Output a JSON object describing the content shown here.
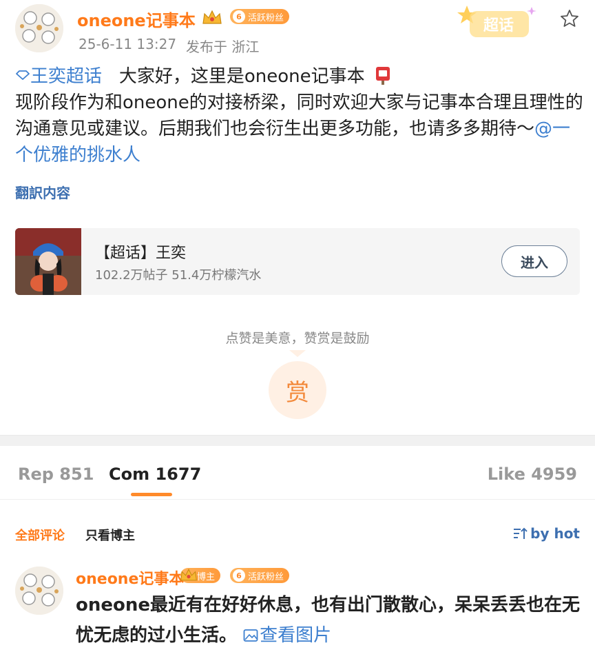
{
  "post": {
    "username": "oneone记事本",
    "fan_badge": {
      "level": "6",
      "label": "活跃粉丝"
    },
    "timestamp": "25-6-11 13:27",
    "location": "发布于 浙江",
    "supertopic_tag": "超话",
    "topic_link": "王奕超话",
    "line1_text": "大家好，这里是oneone记事本",
    "body_text": "现阶段作为和oneone的对接桥梁，同时欢迎大家与记事本合理且理性的沟通意见或建议。后期我们也会衍生出更多功能，也请多多期待～",
    "mention": "@一个优雅的挑水人",
    "translate_label": "翻訳内容"
  },
  "topic_card": {
    "title": "【超话】王奕",
    "stats": "102.2万帖子 51.4万柠檬汽水",
    "enter_label": "进入"
  },
  "reward": {
    "hint": "点赞是美意，赞赏是鼓励",
    "button_label": "赏"
  },
  "tabs": {
    "reposts": "Rep 851",
    "comments": "Com 1677",
    "likes": "Like 4959"
  },
  "filters": {
    "all": "全部评论",
    "op_only": "只看博主",
    "sort": "by hot"
  },
  "comment": {
    "username": "oneone记事本",
    "owner_badge": "博主",
    "fan_badge": {
      "level": "6",
      "label": "活跃粉丝"
    },
    "text": "oneone最近有在好好休息，也有出门散散心，呆呆丢丢也在无忧无虑的过小生活。",
    "view_pic_label": "查看图片"
  },
  "colors": {
    "accent_orange": "#ff7a1a",
    "link_blue": "#3d7fcf",
    "muted": "#888888"
  }
}
